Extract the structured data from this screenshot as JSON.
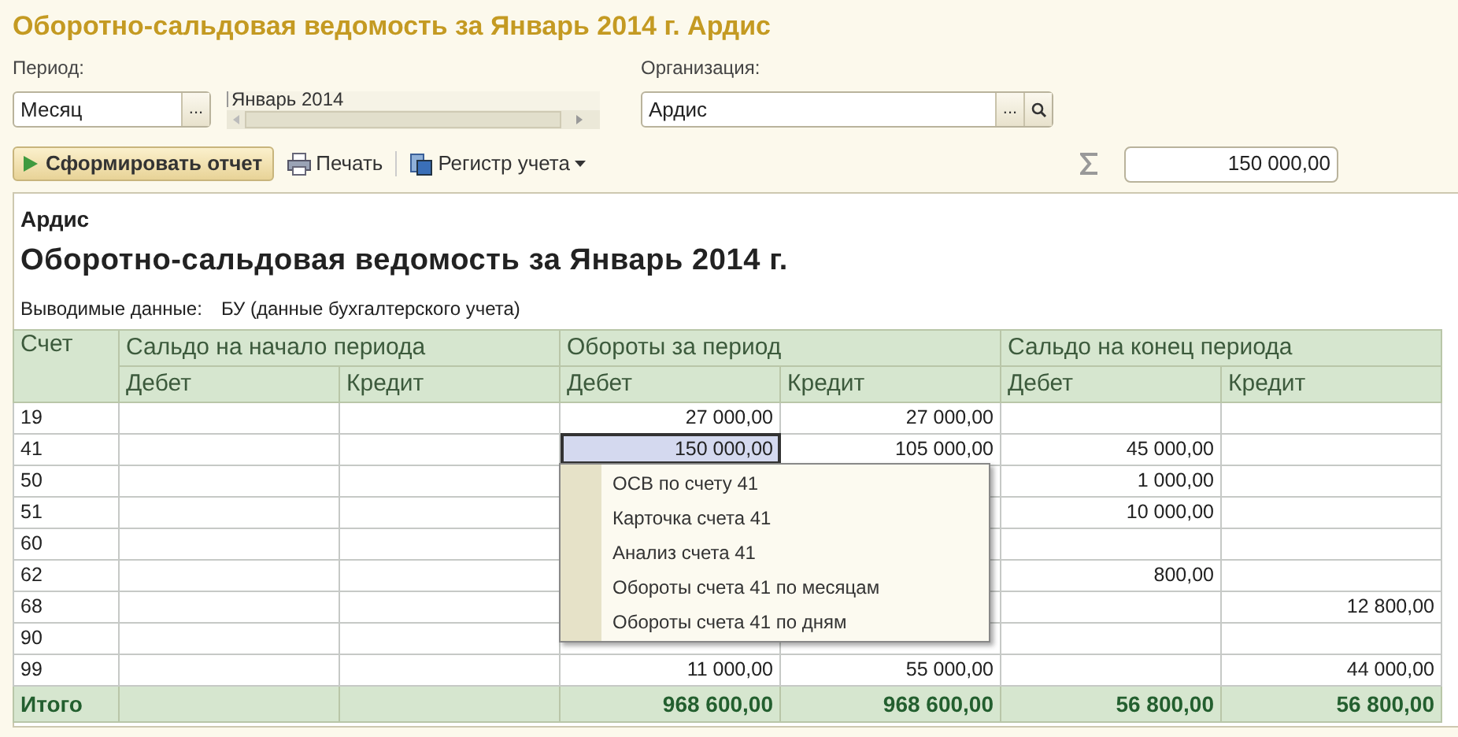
{
  "window": {
    "title": "Оборотно-сальдовая ведомость за Январь 2014 г. Ардис"
  },
  "filters": {
    "period_label": "Период:",
    "period_type": "Месяц",
    "period_choose_button": "...",
    "organization_choose_button": "...",
    "period_value": "Январь 2014",
    "organization_label": "Организация:",
    "organization": "Ардис"
  },
  "toolbar": {
    "generate": "Сформировать отчет",
    "print": "Печать",
    "register": "Регистр учета",
    "sum": "150 000,00"
  },
  "report": {
    "organization": "Ардис",
    "title": "Оборотно-сальдовая ведомость за Январь 2014 г.",
    "data_label": "Выводимые данные:",
    "data_value": "БУ (данные бухгалтерского учета)"
  },
  "table": {
    "header_groups": [
      "Счет",
      "Сальдо на начало периода",
      "Обороты за период",
      "Сальдо на конец периода"
    ],
    "subheaders": [
      "Дебет",
      "Кредит",
      "Дебет",
      "Кредит",
      "Дебет",
      "Кредит"
    ],
    "rows": [
      {
        "account": "19",
        "turnover_debit": "27 000,00",
        "turnover_credit": "27 000,00"
      },
      {
        "account": "41",
        "turnover_debit": {
          "text": "150 000,00",
          "selected": true
        },
        "turnover_credit": "105 000,00",
        "closing_debit": "45 000,00"
      },
      {
        "account": "50",
        "closing_debit": "1 000,00"
      },
      {
        "account": "51",
        "closing_debit": "10 000,00"
      },
      {
        "account": "60"
      },
      {
        "account": "62",
        "closing_debit": "800,00"
      },
      {
        "account": "68",
        "closing_credit": "12 800,00"
      },
      {
        "account": "90"
      },
      {
        "account": "99",
        "turnover_debit": "11 000,00",
        "turnover_credit": "55 000,00",
        "closing_credit": "44 000,00"
      }
    ],
    "total": {
      "label": "Итого",
      "turnover_debit": "968 600,00",
      "turnover_credit": "968 600,00",
      "closing_debit": "56 800,00",
      "closing_credit": "56 800,00"
    }
  },
  "context_menu": [
    "ОСВ по счету 41",
    "Карточка счета 41",
    "Анализ счета 41",
    "Обороты счета 41 по месяцам",
    "Обороты счета 41 по дням"
  ]
}
